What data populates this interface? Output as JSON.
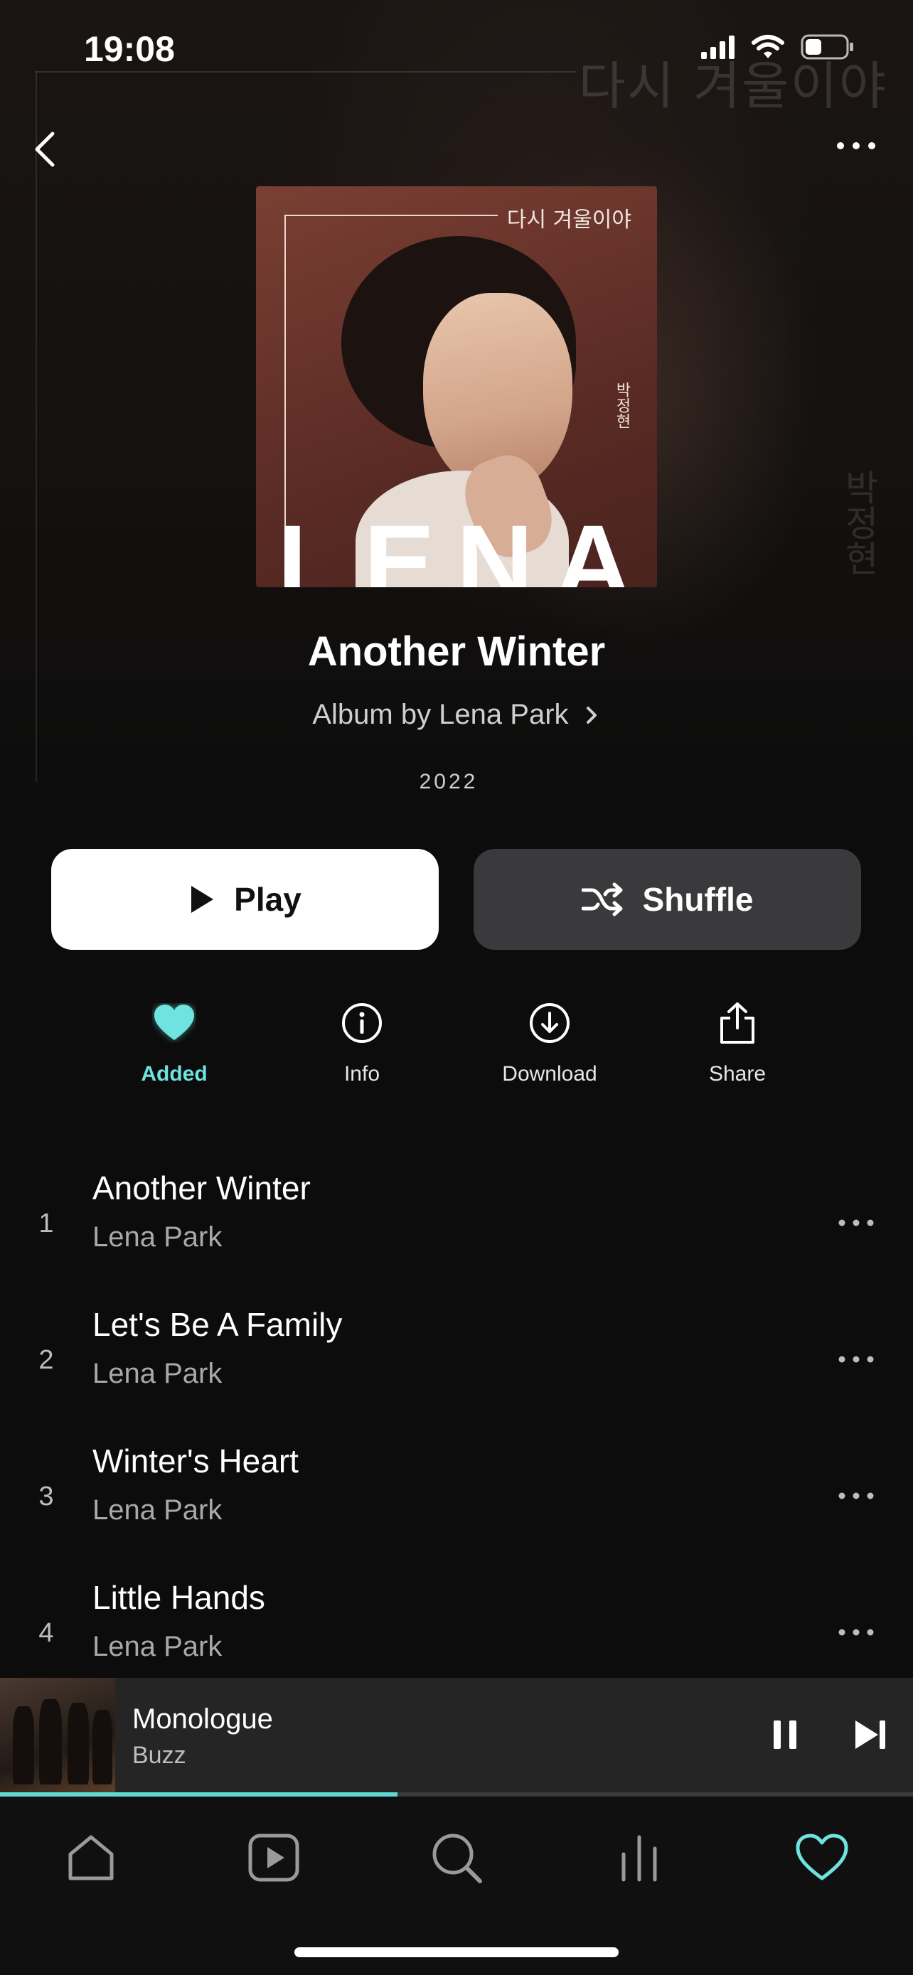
{
  "status_bar": {
    "time": "19:08"
  },
  "background": {
    "korean_title": "다시 겨울이야",
    "korean_artist": "박정현"
  },
  "cover": {
    "korean_title": "다시 겨울이야",
    "korean_artist": "박정현",
    "lettering": "LENA"
  },
  "album": {
    "title": "Another Winter",
    "subtitle": "Album by Lena Park",
    "year": "2022"
  },
  "buttons": {
    "play": "Play",
    "shuffle": "Shuffle"
  },
  "actions": [
    {
      "label": "Added",
      "icon": "heart-filled-icon"
    },
    {
      "label": "Info",
      "icon": "info-icon"
    },
    {
      "label": "Download",
      "icon": "download-icon"
    },
    {
      "label": "Share",
      "icon": "share-icon"
    }
  ],
  "tracks": [
    {
      "number": "1",
      "title": "Another Winter",
      "artist": "Lena Park"
    },
    {
      "number": "2",
      "title": "Let's Be A Family",
      "artist": "Lena Park"
    },
    {
      "number": "3",
      "title": "Winter's Heart",
      "artist": "Lena Park"
    },
    {
      "number": "4",
      "title": "Little Hands",
      "artist": "Lena Park"
    }
  ],
  "now_playing": {
    "title": "Monologue",
    "artist": "Buzz",
    "progress": 0.435
  },
  "tabbar": {
    "items": [
      "home-icon",
      "videos-icon",
      "search-icon",
      "charts-icon",
      "my-collection-icon"
    ],
    "active": "my-collection-icon"
  },
  "colors": {
    "accent": "#5fd9d3",
    "background": "#0c0c0c",
    "shuffle_button": "#3a3a3c"
  }
}
